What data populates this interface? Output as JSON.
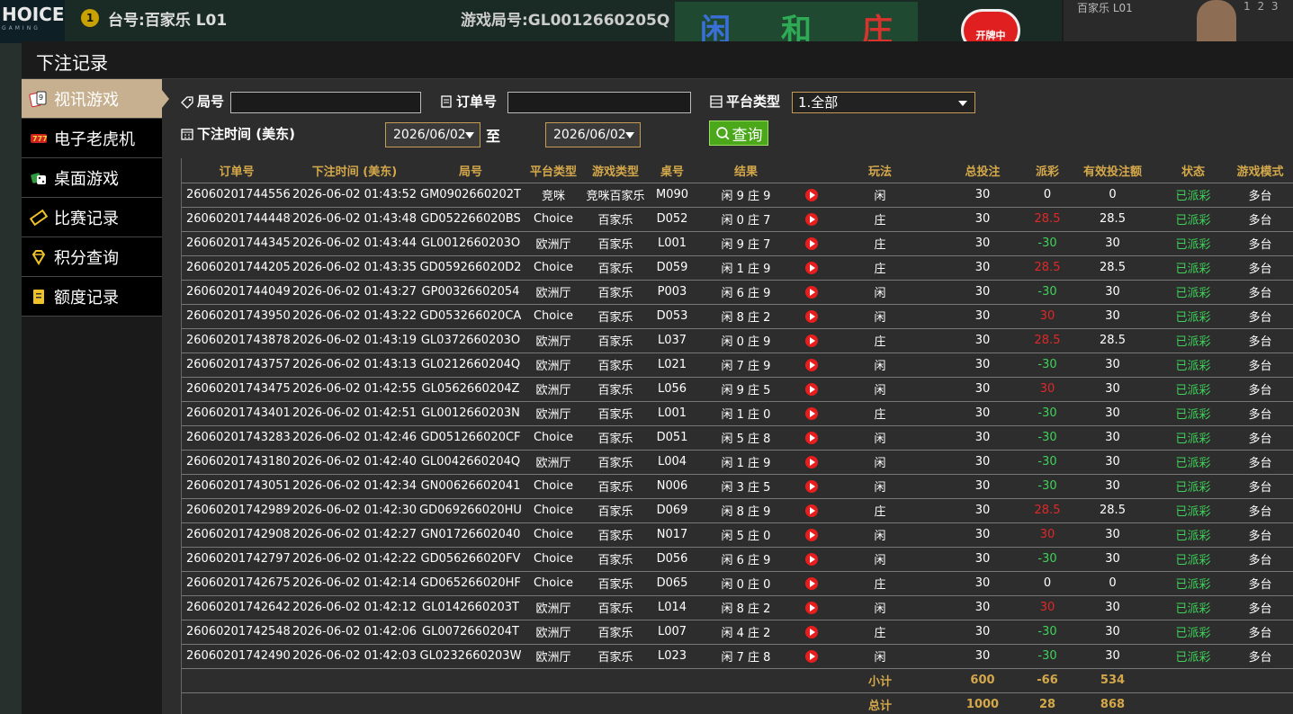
{
  "background": {
    "logo": "HOICE",
    "logo_sub": "GAMING",
    "table_num": "1",
    "table_label": "台号:百家乐 L01",
    "round_label": "游戏局号:GL0012660205Q",
    "bet_player": "闲",
    "bet_tie": "和",
    "bet_banker": "庄",
    "open_label": "开牌中",
    "right_label": "百家乐 L01",
    "right_nums": "1 2 3"
  },
  "modal": {
    "title": "下注记录"
  },
  "sidebar": {
    "items": [
      {
        "label": "视讯游戏",
        "icon": "playing-cards-icon",
        "active": true
      },
      {
        "label": "电子老虎机",
        "icon": "slot-machine-icon",
        "active": false
      },
      {
        "label": "桌面游戏",
        "icon": "dice-icon",
        "active": false
      },
      {
        "label": "比赛记录",
        "icon": "ticket-icon",
        "active": false
      },
      {
        "label": "积分查询",
        "icon": "diamond-icon",
        "active": false
      },
      {
        "label": "额度记录",
        "icon": "document-icon",
        "active": false
      }
    ]
  },
  "filters": {
    "round_label": "局号",
    "round_value": "",
    "order_label": "订单号",
    "order_value": "",
    "platform_label": "平台类型",
    "platform_selected": "1.全部",
    "time_label": "下注时间 (美东)",
    "date_from": "2026/06/02",
    "to_label": "至",
    "date_to": "2026/06/02",
    "query_label": "查询"
  },
  "table": {
    "headers": [
      "订单号",
      "下注时间 (美东)",
      "局号",
      "平台类型",
      "游戏类型",
      "桌号",
      "结果",
      "",
      "玩法",
      "总投注",
      "派彩",
      "有效投注额",
      "状态",
      "游戏模式"
    ],
    "rows": [
      [
        "260602017445561",
        "2026-06-02 01:43:52",
        "GM0902660202T",
        "竞咪",
        "竞咪百家乐",
        "M090",
        "闲 9 庄 9",
        "",
        "闲",
        "30",
        "0",
        "0",
        "已派彩",
        "多台"
      ],
      [
        "260602017444489",
        "2026-06-02 01:43:48",
        "GD052266020BS",
        "Choice",
        "百家乐",
        "D052",
        "闲 0 庄 7",
        "",
        "庄",
        "30",
        "28.5",
        "28.5",
        "已派彩",
        "多台"
      ],
      [
        "260602017443456",
        "2026-06-02 01:43:44",
        "GL0012660203O",
        "欧洲厅",
        "百家乐",
        "L001",
        "闲 9 庄 7",
        "",
        "庄",
        "30",
        "-30",
        "30",
        "已派彩",
        "多台"
      ],
      [
        "260602017442053",
        "2026-06-02 01:43:35",
        "GD059266020D2",
        "Choice",
        "百家乐",
        "D059",
        "闲 1 庄 9",
        "",
        "庄",
        "30",
        "28.5",
        "28.5",
        "已派彩",
        "多台"
      ],
      [
        "260602017440497",
        "2026-06-02 01:43:27",
        "GP00326602054",
        "欧洲厅",
        "百家乐",
        "P003",
        "闲 6 庄 9",
        "",
        "闲",
        "30",
        "-30",
        "30",
        "已派彩",
        "多台"
      ],
      [
        "260602017439505",
        "2026-06-02 01:43:22",
        "GD053266020CA",
        "Choice",
        "百家乐",
        "D053",
        "闲 8 庄 2",
        "",
        "闲",
        "30",
        "30",
        "30",
        "已派彩",
        "多台"
      ],
      [
        "260602017438782",
        "2026-06-02 01:43:19",
        "GL0372660203O",
        "欧洲厅",
        "百家乐",
        "L037",
        "闲 0 庄 9",
        "",
        "庄",
        "30",
        "28.5",
        "28.5",
        "已派彩",
        "多台"
      ],
      [
        "260602017437577",
        "2026-06-02 01:43:13",
        "GL0212660204Q",
        "欧洲厅",
        "百家乐",
        "L021",
        "闲 7 庄 9",
        "",
        "闲",
        "30",
        "-30",
        "30",
        "已派彩",
        "多台"
      ],
      [
        "260602017434755",
        "2026-06-02 01:42:55",
        "GL0562660204Z",
        "欧洲厅",
        "百家乐",
        "L056",
        "闲 9 庄 5",
        "",
        "闲",
        "30",
        "30",
        "30",
        "已派彩",
        "多台"
      ],
      [
        "260602017434018",
        "2026-06-02 01:42:51",
        "GL0012660203N",
        "欧洲厅",
        "百家乐",
        "L001",
        "闲 1 庄 0",
        "",
        "庄",
        "30",
        "-30",
        "30",
        "已派彩",
        "多台"
      ],
      [
        "260602017432838",
        "2026-06-02 01:42:46",
        "GD051266020CF",
        "Choice",
        "百家乐",
        "D051",
        "闲 5 庄 8",
        "",
        "闲",
        "30",
        "-30",
        "30",
        "已派彩",
        "多台"
      ],
      [
        "260602017431801",
        "2026-06-02 01:42:40",
        "GL0042660204Q",
        "欧洲厅",
        "百家乐",
        "L004",
        "闲 1 庄 9",
        "",
        "闲",
        "30",
        "-30",
        "30",
        "已派彩",
        "多台"
      ],
      [
        "260602017430515",
        "2026-06-02 01:42:34",
        "GN00626602041",
        "Choice",
        "百家乐",
        "N006",
        "闲 3 庄 5",
        "",
        "闲",
        "30",
        "-30",
        "30",
        "已派彩",
        "多台"
      ],
      [
        "260602017429890",
        "2026-06-02 01:42:30",
        "GD069266020HU",
        "Choice",
        "百家乐",
        "D069",
        "闲 8 庄 9",
        "",
        "庄",
        "30",
        "28.5",
        "28.5",
        "已派彩",
        "多台"
      ],
      [
        "260602017429083",
        "2026-06-02 01:42:27",
        "GN01726602040",
        "Choice",
        "百家乐",
        "N017",
        "闲 5 庄 0",
        "",
        "闲",
        "30",
        "30",
        "30",
        "已派彩",
        "多台"
      ],
      [
        "260602017427975",
        "2026-06-02 01:42:22",
        "GD056266020FV",
        "Choice",
        "百家乐",
        "D056",
        "闲 6 庄 9",
        "",
        "闲",
        "30",
        "-30",
        "30",
        "已派彩",
        "多台"
      ],
      [
        "260602017426753",
        "2026-06-02 01:42:14",
        "GD065266020HF",
        "Choice",
        "百家乐",
        "D065",
        "闲 0 庄 0",
        "",
        "庄",
        "30",
        "0",
        "0",
        "已派彩",
        "多台"
      ],
      [
        "260602017426422",
        "2026-06-02 01:42:12",
        "GL0142660203T",
        "欧洲厅",
        "百家乐",
        "L014",
        "闲 8 庄 2",
        "",
        "闲",
        "30",
        "30",
        "30",
        "已派彩",
        "多台"
      ],
      [
        "260602017425483",
        "2026-06-02 01:42:06",
        "GL0072660204T",
        "欧洲厅",
        "百家乐",
        "L007",
        "闲 4 庄 2",
        "",
        "庄",
        "30",
        "-30",
        "30",
        "已派彩",
        "多台"
      ],
      [
        "260602017424903",
        "2026-06-02 01:42:03",
        "GL0232660203W",
        "欧洲厅",
        "百家乐",
        "L023",
        "闲 7 庄 8",
        "",
        "闲",
        "30",
        "-30",
        "30",
        "已派彩",
        "多台"
      ]
    ],
    "subtotal": {
      "label": "小计",
      "total_bet": "600",
      "payout": "-66",
      "valid_bet": "534"
    },
    "total": {
      "label": "总计",
      "total_bet": "1000",
      "payout": "28",
      "valid_bet": "868"
    }
  },
  "colors": {
    "accent_gold": "#d4a84a",
    "positive_green": "#3fd15a",
    "negative_red": "#e02828",
    "active_tab": "#c7b08f",
    "query_green": "#4aa81a"
  }
}
